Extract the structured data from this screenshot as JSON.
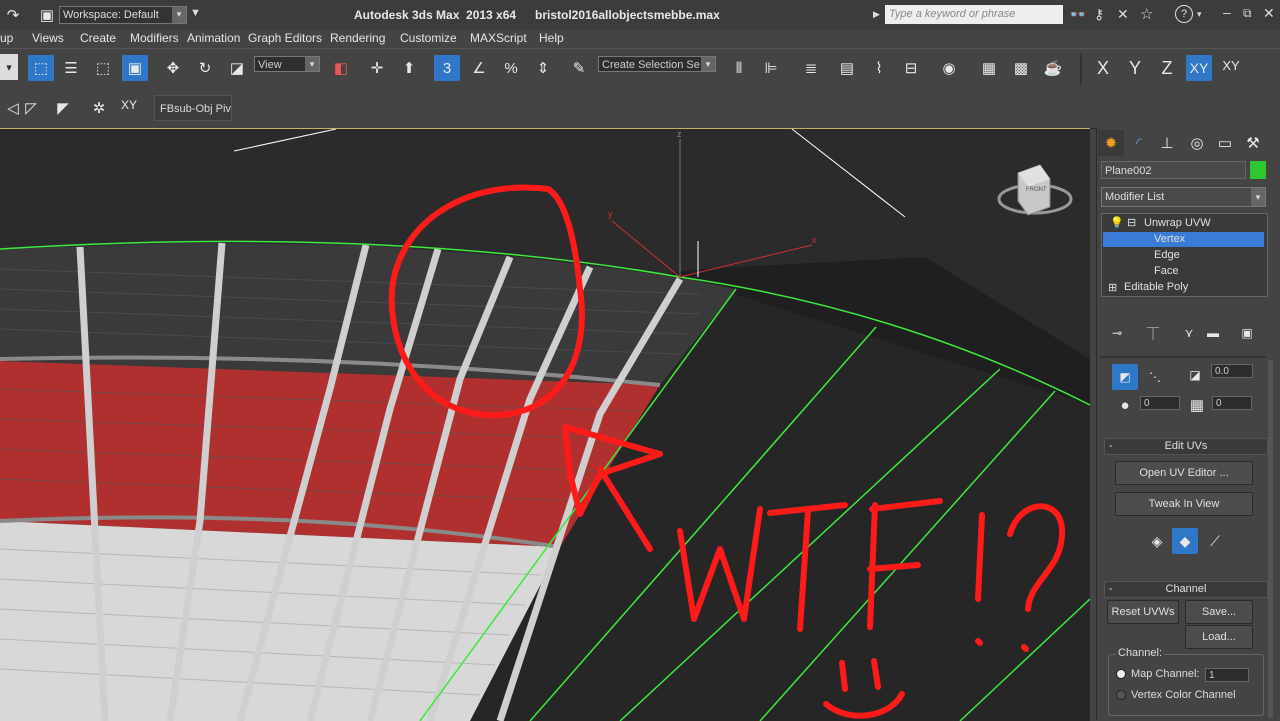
{
  "titlebar": {
    "workspace": "Workspace: Default",
    "app_title": "Autodesk 3ds Max  2013 x64",
    "file_name": "bristol2016allobjectsmebbe.max",
    "search_placeholder": "Type a keyword or phrase"
  },
  "menu": [
    "up",
    "Views",
    "Create",
    "Modifiers",
    "Animation",
    "Graph Editors",
    "Rendering",
    "Customize",
    "MAXScript",
    "Help"
  ],
  "toolbar": {
    "ref_coord": "View",
    "selection_set": "Create Selection Se",
    "axis_x": "X",
    "axis_y": "Y",
    "axis_z": "Z",
    "axis_xy": "XY",
    "axis_xy2": "XY",
    "snap_label": "3",
    "percent_label": "%"
  },
  "toolbar2": {
    "xy_label": "XY",
    "fbsub": "FBsub-Obj Piv"
  },
  "viewport": {
    "axis_x": "x",
    "axis_y": "y",
    "axis_z": "z",
    "cube_label": "FRONT",
    "annotation": "WTF!?"
  },
  "panel": {
    "object_name": "Plane002",
    "object_color": "#2ec82e",
    "modifier_list": "Modifier List",
    "stack": [
      {
        "label": "Unwrap UVW"
      },
      {
        "label": "Vertex"
      },
      {
        "label": "Edge"
      },
      {
        "label": "Face"
      },
      {
        "label": "Editable Poly"
      }
    ],
    "spin1": "0.0",
    "spin2": "0",
    "spin3": "0",
    "edit_uvs_title": "Edit UVs",
    "open_uv_editor": "Open UV Editor ...",
    "tweak_in_view": "Tweak In View",
    "channel_title": "Channel",
    "reset_uvws": "Reset UVWs",
    "save": "Save...",
    "load": "Load...",
    "channel_label": "Channel:",
    "map_channel": "Map Channel:",
    "map_channel_value": "1",
    "vertex_color_channel": "Vertex Color Channel"
  },
  "colors": {
    "accent": "#2f78c8",
    "annotation": "#ff1a1a",
    "edge_green": "#3ee83e"
  }
}
